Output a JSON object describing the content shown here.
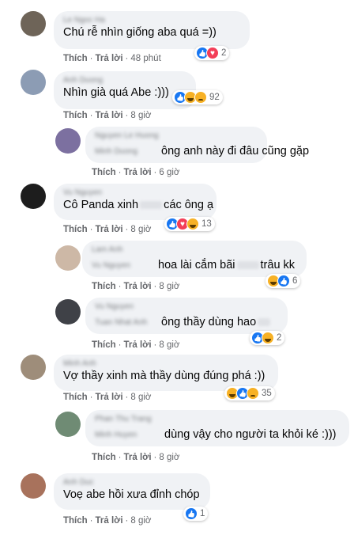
{
  "labels": {
    "like": "Thích",
    "reply": "Trả lời",
    "dot": "·"
  },
  "colors": {
    "bubble": "#f0f2f5",
    "meta": "#65676b",
    "like": "#1877f2",
    "love": "#f33e58",
    "haha": "#f7b125"
  },
  "comments": [
    {
      "author": "Le Ngoc Ha",
      "text": "Chú rễ nhìn giống aba quá =))",
      "time": "48 phút",
      "reactions": [
        "like-icon",
        "love-icon"
      ],
      "count": "2"
    },
    {
      "author": "Anh Duong",
      "text": "Nhìn già quá Abe :)))",
      "time": "8 giờ",
      "reactions": [
        "like-icon",
        "haha-icon",
        "sad-icon"
      ],
      "count": "92"
    },
    {
      "author": "Nguyen Le Huong",
      "author2": "Minh Duong",
      "text": "ông anh này đi đâu cũng gặp",
      "time": "6 giờ"
    },
    {
      "author": "Vu Nguyen",
      "text_a": "Cô Panda xinh",
      "text_b": "các ông ạ",
      "time": "8 giờ",
      "reactions": [
        "like-icon",
        "love-icon",
        "haha-icon"
      ],
      "count": "13"
    },
    {
      "author": "Lam Anh",
      "author2": "Vu Nguyen",
      "text_a": "hoa lài cắm bãi",
      "text_b": "trâu kk",
      "time": "8 giờ",
      "reactions": [
        "haha-icon",
        "like-icon"
      ],
      "count": "6"
    },
    {
      "author": "Vu Nguyen",
      "author2": "Tuan Nhat Anh",
      "text_b": "ông thầy dùng hao",
      "time": "8 giờ",
      "reactions": [
        "like-icon",
        "haha-icon"
      ],
      "count": "2"
    },
    {
      "author": "Minh Anh",
      "text": "Vợ thầy xinh mà thầy dùng đúng phá :))",
      "time": "8 giờ",
      "reactions": [
        "haha-icon",
        "like-icon",
        "sad-icon"
      ],
      "count": "35"
    },
    {
      "author": "Phan Thu Trang",
      "author2": "Minh Huyen",
      "text_b": "dùng vậy cho người ta khỏi ké :)))",
      "time": "8 giờ"
    },
    {
      "author": "Anh Duc",
      "text": "Voẹ abe hồi xưa đỉnh chóp",
      "time": "8 giờ",
      "reactions": [
        "like-icon"
      ],
      "count": "1"
    }
  ]
}
